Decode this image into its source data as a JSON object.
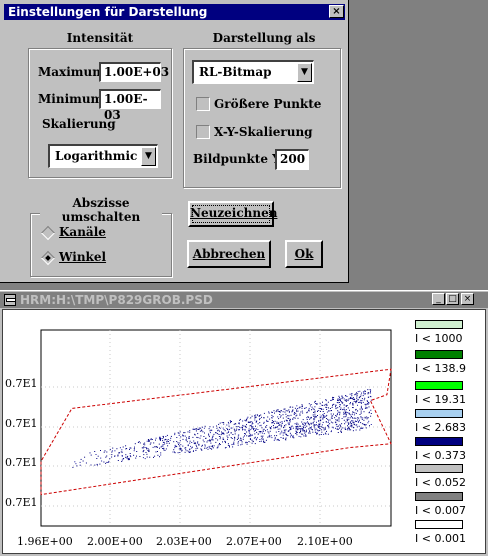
{
  "dialog": {
    "title": "Einstellungen für Darstellung",
    "intensity": {
      "heading": "Intensität",
      "maximum_label": "Maximum",
      "maximum_value": "1.00E+03",
      "minimum_label": "Minimum",
      "minimum_value": "1.00E-03",
      "scaling_label": "Skalierung",
      "scaling_value": "Logarithmic"
    },
    "display": {
      "heading": "Darstellung als",
      "mode_value": "RL-Bitmap",
      "bigger_points_label": "Größere Punkte",
      "xy_scaling_label": "X-Y-Skalierung",
      "pixels_y_label": "Bildpunkte Y",
      "pixels_y_value": "200"
    },
    "abscissa": {
      "heading": "Abszisse umschalten",
      "channels_label": "Kanäle",
      "angle_label": "Winkel"
    },
    "buttons": {
      "redraw": "Neuzeichnen",
      "cancel": "Abbrechen",
      "ok": "Ok"
    }
  },
  "plot_window": {
    "title": "HRM:H:\\TMP\\P829GROB.PSD",
    "legend": [
      {
        "label": "I < 1000",
        "color": "#d0f0d0"
      },
      {
        "label": "I < 138.9",
        "color": "#008000"
      },
      {
        "label": "I < 19.31",
        "color": "#00ff00"
      },
      {
        "label": "I < 2.683",
        "color": "#a8d0f0"
      },
      {
        "label": "I < 0.373",
        "color": "#000080"
      },
      {
        "label": "I < 0.052",
        "color": "#c0c0c0"
      },
      {
        "label": "I < 0.007",
        "color": "#808080"
      },
      {
        "label": "I < 0.001",
        "color": "#ffffff"
      }
    ]
  },
  "chart_data": {
    "type": "scatter",
    "x_tick_labels": [
      "1.96E+00",
      "2.00E+00",
      "2.03E+00",
      "2.07E+00",
      "2.10E+00"
    ],
    "y_tick_labels": [
      "0.7E1",
      "0.7E1",
      "0.7E1",
      "0.7E1"
    ],
    "xlim": [
      1.96,
      2.13
    ],
    "boundary": {
      "color": "#cc0000",
      "x": [
        1.96,
        1.96,
        1.975,
        2.13,
        2.128,
        2.12,
        2.13,
        2.11,
        1.96
      ],
      "y": [
        0.16,
        0.33,
        0.6,
        0.8,
        0.67,
        0.64,
        0.42,
        0.4,
        0.16
      ]
    },
    "series_color": "#000080",
    "grid": true
  }
}
